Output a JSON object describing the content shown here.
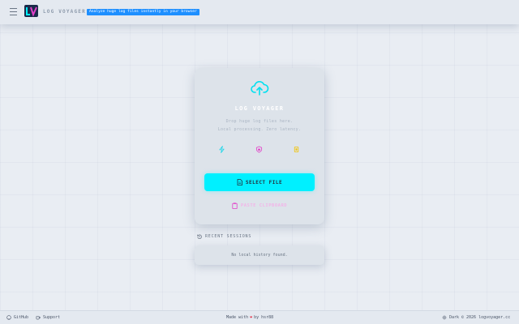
{
  "header": {
    "brand": "LOG VOYAGER",
    "tagline": "Analyze huge log files instantly in your browser",
    "menu_icon": "hamburger-menu-icon",
    "logo_icon": "log-voyager-logo"
  },
  "upload_card": {
    "icon": "cloud-upload-icon",
    "title": "LOG VOYAGER",
    "description_line1": "Drop huge log files here.",
    "description_line2": "Local processing. Zero latency.",
    "features": [
      {
        "icon": "lightning-icon",
        "color": "#00d4e8"
      },
      {
        "icon": "shield-icon",
        "color": "#e23fc8"
      },
      {
        "icon": "cpu-icon",
        "color": "#f2c200"
      }
    ],
    "select_button_label": "SELECT FILE",
    "paste_button_label": "PASTE CLIPBOARD"
  },
  "recent": {
    "heading": "RECENT SESSIONS",
    "empty_message": "No local history found."
  },
  "footer": {
    "github_label": "GitHub",
    "support_label": "Support",
    "made_with_prefix": "Made with",
    "made_with_suffix": "by hsr88",
    "theme_label": "Dark",
    "copyright": "© 2026 logvoyager.cc"
  },
  "colors": {
    "accent_cyan": "#00f0ff",
    "accent_magenta": "#e23fc8",
    "accent_yellow": "#f2c200",
    "tagline_blue": "#1e8fff",
    "heart_red": "#e2354a",
    "background": "#e9edf3"
  }
}
